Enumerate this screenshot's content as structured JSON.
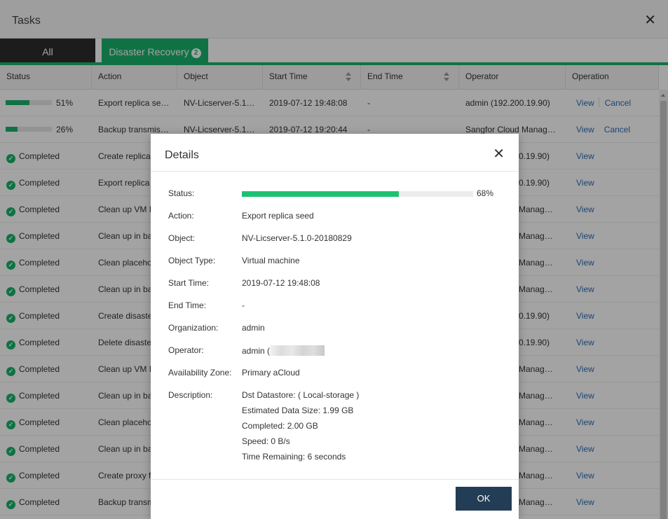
{
  "window": {
    "title": "Tasks"
  },
  "tabs": [
    {
      "label": "All"
    },
    {
      "label": "Disaster Recovery",
      "badge": "2"
    }
  ],
  "columns": {
    "status": "Status",
    "action": "Action",
    "object": "Object",
    "start_time": "Start Time",
    "end_time": "End Time",
    "operator": "Operator",
    "operation": "Operation"
  },
  "rows": [
    {
      "progress": "51%",
      "progress_value": 0.51,
      "action": "Export replica se…",
      "object": "NV-Licserver-5.1…",
      "start": "2019-07-12 19:48:08",
      "end": "-",
      "operator": "admin (192.200.19.90)",
      "view": "View",
      "cancel": "Cancel"
    },
    {
      "progress": "26%",
      "progress_value": 0.26,
      "action": "Backup transmis…",
      "object": "NV-Licserver-5.1…",
      "start": "2019-07-12 19:20:44",
      "end": "-",
      "operator": "Sangfor Cloud Manag…",
      "view": "View",
      "cancel": "Cancel"
    },
    {
      "status": "Completed",
      "action": "Create replica",
      "operator": "0.19.90)",
      "view": "View"
    },
    {
      "status": "Completed",
      "action": "Export replica",
      "operator": "0.19.90)",
      "view": "View"
    },
    {
      "status": "Completed",
      "action": "Clean up VM I",
      "operator": "Manag…",
      "view": "View"
    },
    {
      "status": "Completed",
      "action": "Clean up in ba",
      "operator": "Manag…",
      "view": "View"
    },
    {
      "status": "Completed",
      "action": "Clean placeho",
      "operator": "Manag…",
      "view": "View"
    },
    {
      "status": "Completed",
      "action": "Clean up in ba",
      "operator": "Manag…",
      "view": "View"
    },
    {
      "status": "Completed",
      "action": "Create disaste",
      "operator": "0.19.90)",
      "view": "View"
    },
    {
      "status": "Completed",
      "action": "Delete disaste",
      "operator": "0.19.90)",
      "view": "View"
    },
    {
      "status": "Completed",
      "action": "Clean up VM I",
      "operator": "Manag…",
      "view": "View"
    },
    {
      "status": "Completed",
      "action": "Clean up in ba",
      "operator": "Manag…",
      "view": "View"
    },
    {
      "status": "Completed",
      "action": "Clean placeho",
      "operator": "Manag…",
      "view": "View"
    },
    {
      "status": "Completed",
      "action": "Clean up in ba",
      "operator": "Manag…",
      "view": "View"
    },
    {
      "status": "Completed",
      "action": "Create proxy f",
      "operator": "Manag…",
      "view": "View"
    },
    {
      "status": "Completed",
      "action": "Backup transm",
      "operator": "Manag…",
      "view": "View"
    }
  ],
  "dialog": {
    "title": "Details",
    "status_label": "Status:",
    "progress_value": 0.68,
    "progress_text": "68%",
    "action_label": "Action:",
    "action_value": "Export replica seed",
    "object_label": "Object:",
    "object_value": "NV-Licserver-5.1.0-20180829",
    "object_type_label": "Object Type:",
    "object_type_value": "Virtual machine",
    "start_label": "Start Time:",
    "start_value": "2019-07-12 19:48:08",
    "end_label": "End Time:",
    "end_value": "-",
    "org_label": "Organization:",
    "org_value": "admin",
    "operator_label": "Operator:",
    "operator_value": "admin (",
    "zone_label": "Availability Zone:",
    "zone_value": "Primary aCloud",
    "desc_label": "Description:",
    "desc_lines": [
      "Dst Datastore: ( Local-storage )",
      "Estimated Data Size: 1.99 GB",
      "Completed: 2.00 GB",
      "Speed: 0 B/s",
      "Time Remaining: 6 seconds"
    ],
    "ok_label": "OK"
  },
  "colors": {
    "accent": "#1ab26b",
    "dark_tab": "#2d2d2d",
    "link": "#2d6cb5",
    "ok_button": "#243d56"
  }
}
